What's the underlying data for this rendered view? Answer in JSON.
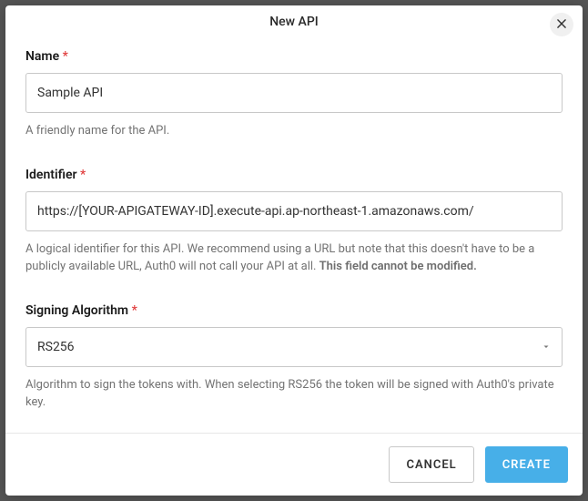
{
  "modal": {
    "title": "New API"
  },
  "form": {
    "name": {
      "label": "Name",
      "required_marker": "*",
      "value": "Sample API",
      "help": "A friendly name for the API."
    },
    "identifier": {
      "label": "Identifier",
      "required_marker": "*",
      "value": "https://[YOUR-APIGATEWAY-ID].execute-api.ap-northeast-1.amazonaws.com/",
      "help_prefix": "A logical identifier for this API. We recommend using a URL but note that this doesn't have to be a publicly available URL, Auth0 will not call your API at all. ",
      "help_bold": "This field cannot be modified."
    },
    "signing_algorithm": {
      "label": "Signing Algorithm",
      "required_marker": "*",
      "value": "RS256",
      "help": "Algorithm to sign the tokens with. When selecting RS256 the token will be signed with Auth0's private key."
    }
  },
  "footer": {
    "cancel": "CANCEL",
    "create": "CREATE"
  }
}
